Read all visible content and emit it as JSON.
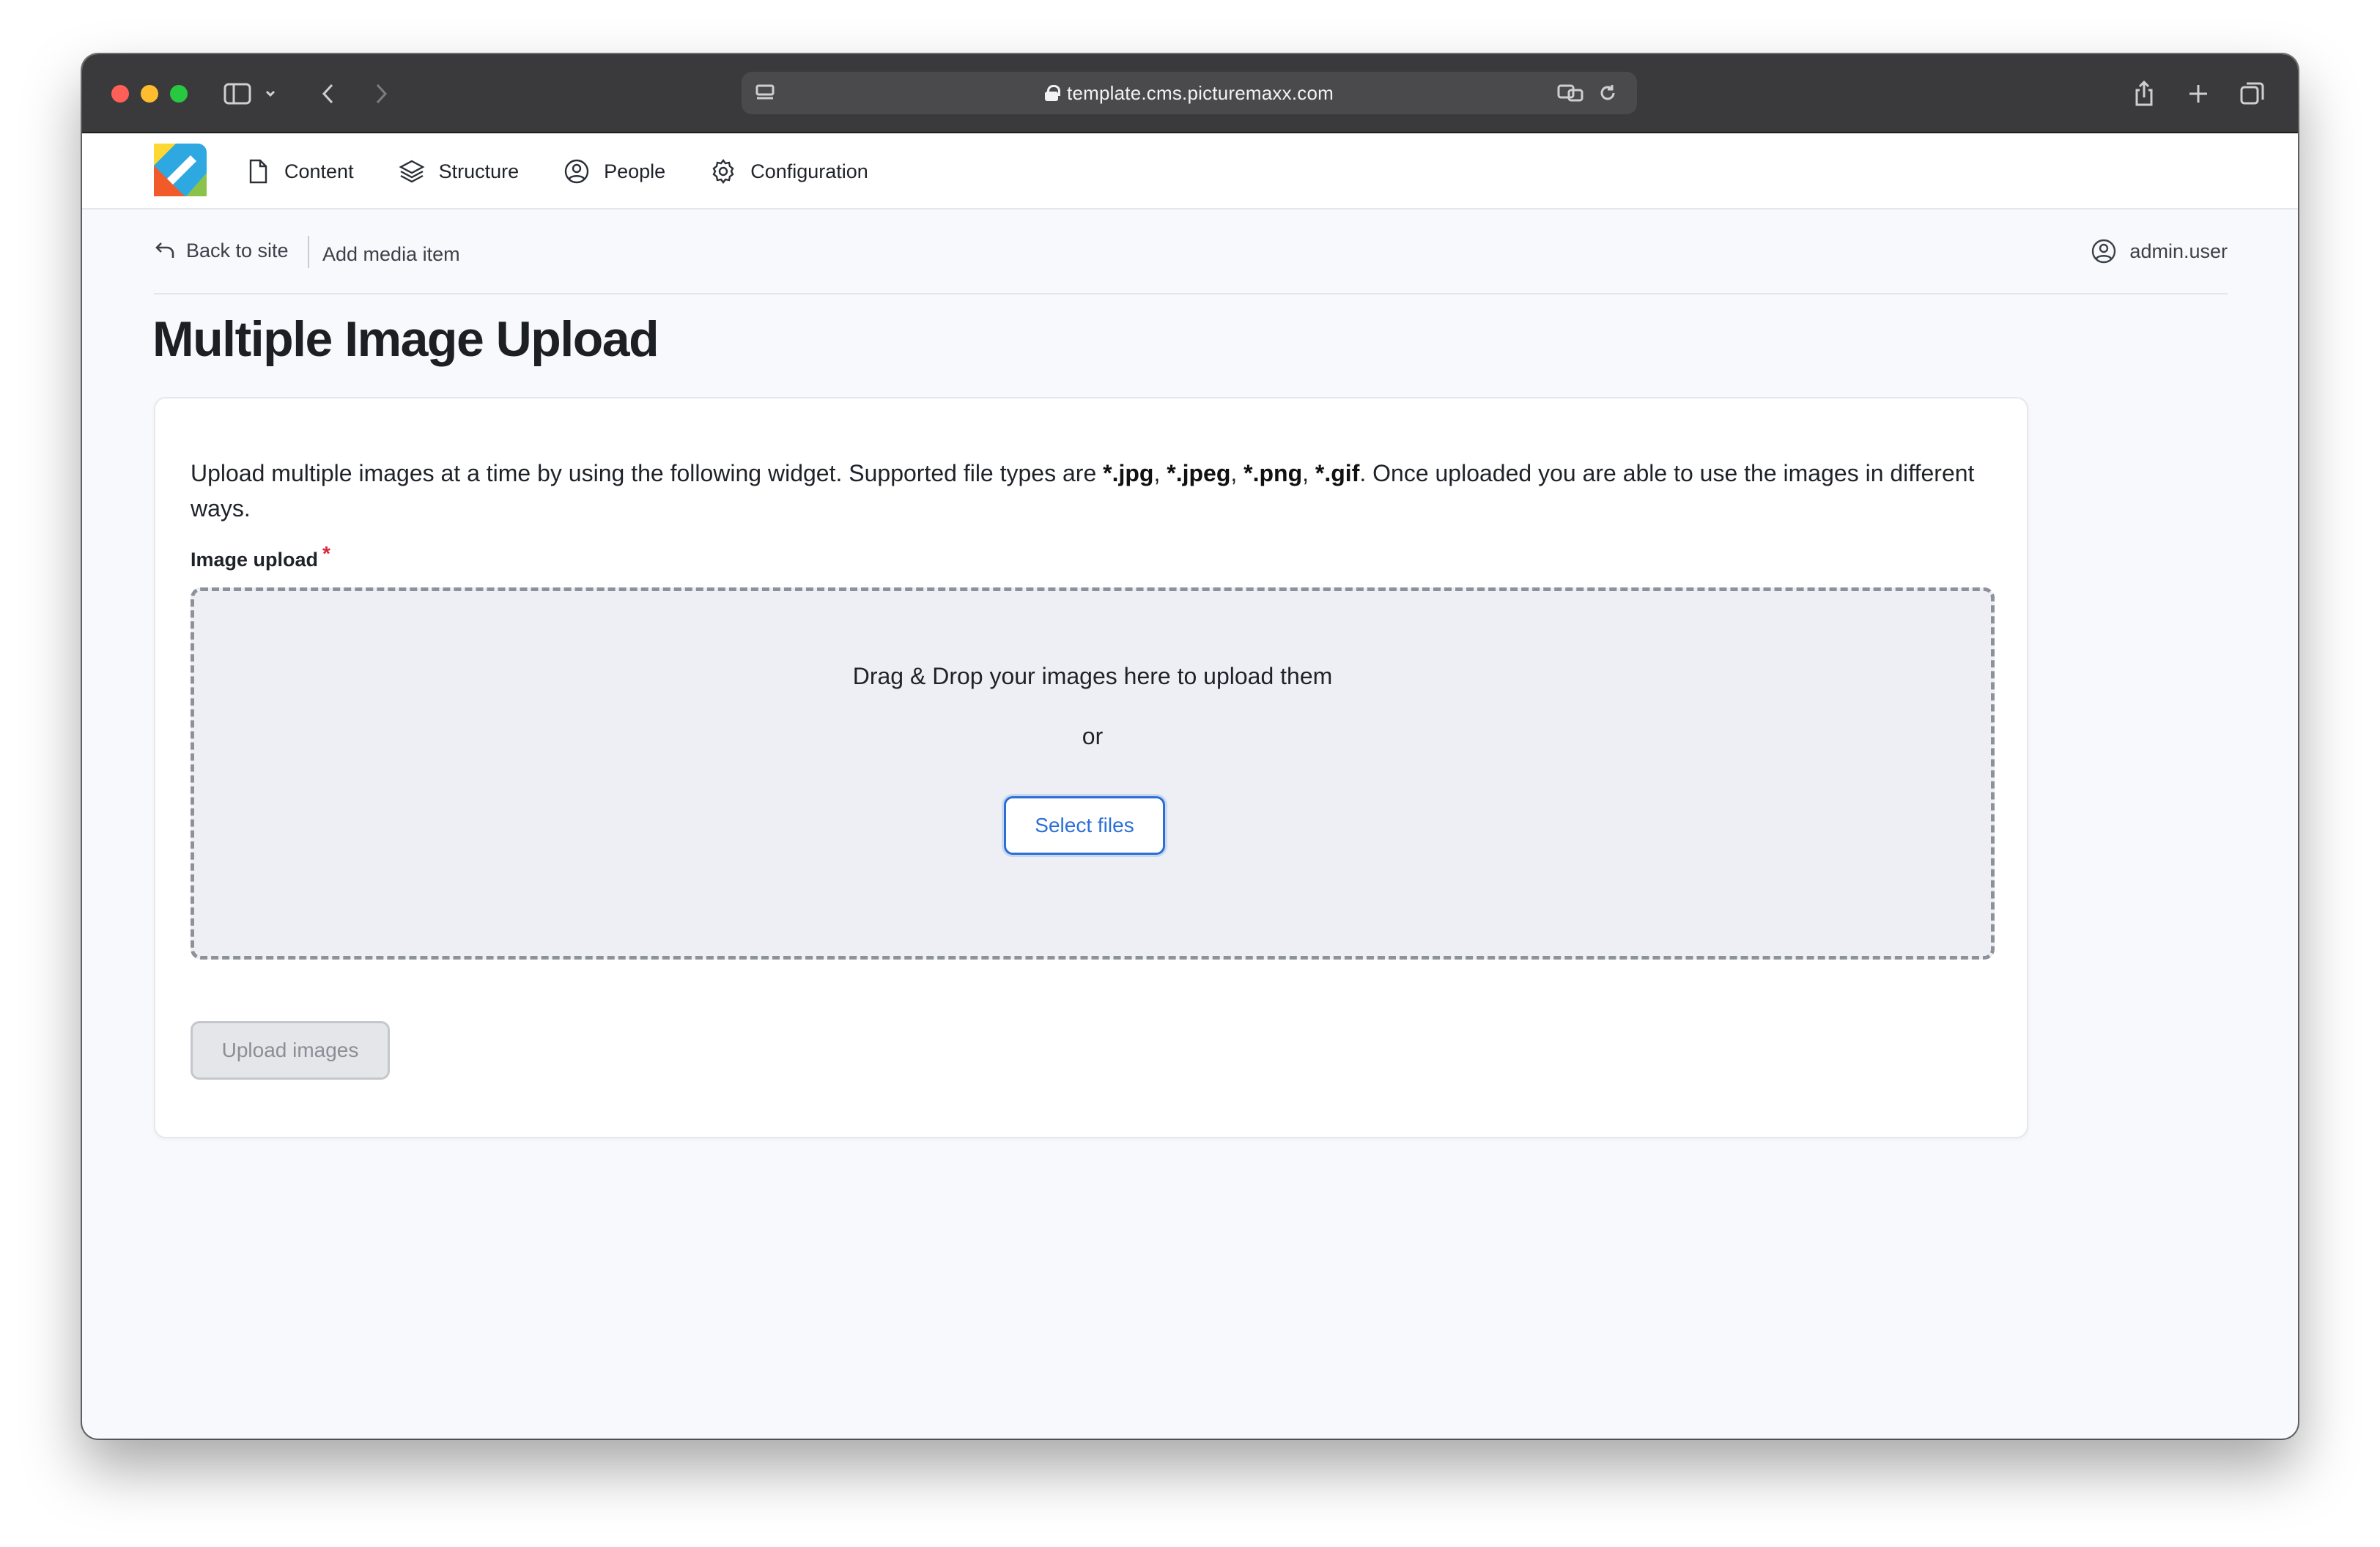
{
  "browser": {
    "url": "template.cms.picturemaxx.com"
  },
  "toolbar": {
    "nav": [
      {
        "label": "Content",
        "icon": "document-icon"
      },
      {
        "label": "Structure",
        "icon": "layers-icon"
      },
      {
        "label": "People",
        "icon": "user-circle-icon"
      },
      {
        "label": "Configuration",
        "icon": "gear-icon"
      }
    ]
  },
  "subbar": {
    "back_label": "Back to site",
    "crumb": "Add media item",
    "user": "admin.user"
  },
  "page": {
    "title": "Multiple Image Upload",
    "intro_prefix": "Upload multiple images at a time by using the following widget. Supported file types are ",
    "types": [
      "*.jpg",
      "*.jpeg",
      "*.png",
      "*.gif"
    ],
    "intro_suffix": ". Once uploaded you are able to use the images in different ways.",
    "field_label": "Image upload",
    "required_mark": "*",
    "dropzone_text": "Drag & Drop your images here to upload them",
    "dropzone_or": "or",
    "select_button": "Select files",
    "upload_button": "Upload images"
  },
  "colors": {
    "accent": "#2b6fd6",
    "required": "#d7263d",
    "chrome": "#3a3a3c"
  }
}
